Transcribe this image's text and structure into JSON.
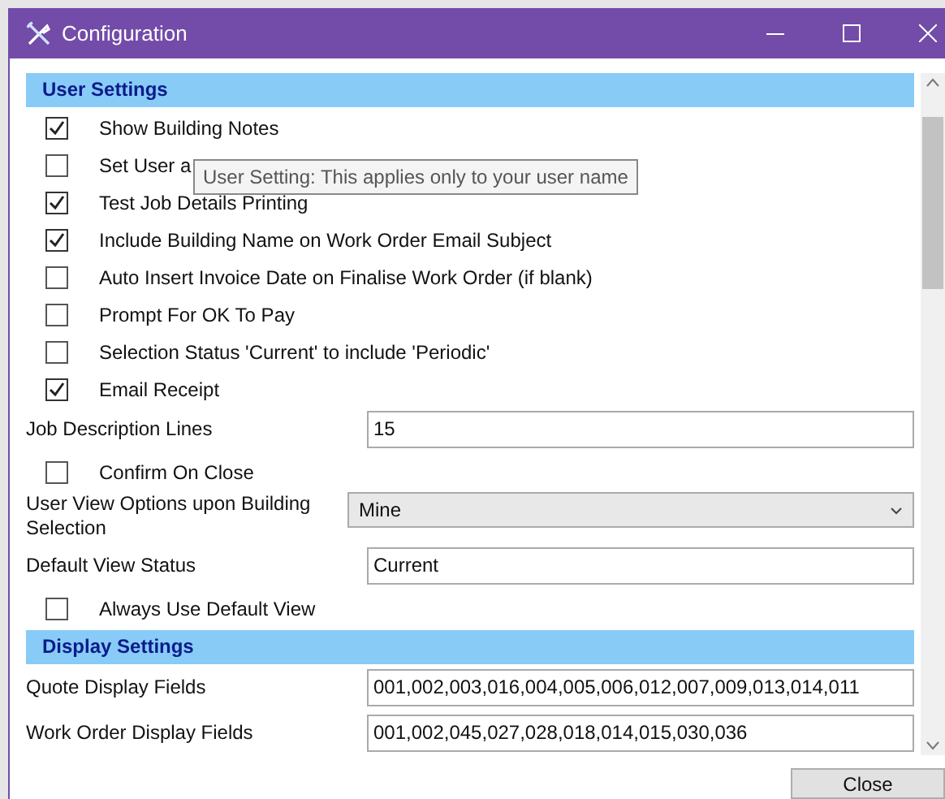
{
  "window": {
    "title": "Configuration"
  },
  "sections": [
    {
      "title": "User Settings",
      "items": [
        {
          "kind": "checkbox",
          "label": "Show Building Notes",
          "checked": true
        },
        {
          "kind": "checkbox",
          "label": "Set User a",
          "checked": false
        },
        {
          "kind": "checkbox",
          "label": "Test Job Details Printing",
          "checked": true
        },
        {
          "kind": "checkbox",
          "label": "Include Building Name on Work Order Email Subject",
          "checked": true
        },
        {
          "kind": "checkbox",
          "label": "Auto Insert Invoice Date on Finalise Work Order (if blank)",
          "checked": false
        },
        {
          "kind": "checkbox",
          "label": "Prompt For OK To Pay",
          "checked": false
        },
        {
          "kind": "checkbox",
          "label": "Selection Status 'Current' to include 'Periodic'",
          "checked": false
        },
        {
          "kind": "checkbox",
          "label": "Email Receipt",
          "checked": true
        },
        {
          "kind": "text",
          "label": "Job Description Lines",
          "value": "15"
        },
        {
          "kind": "checkbox",
          "label": "Confirm On Close",
          "checked": false
        },
        {
          "kind": "dropdown",
          "label": "User View Options upon Building Selection",
          "value": "Mine"
        },
        {
          "kind": "text",
          "label": "Default View Status",
          "value": "Current"
        },
        {
          "kind": "checkbox",
          "label": "Always Use Default View",
          "checked": false
        }
      ]
    },
    {
      "title": "Display Settings",
      "items": [
        {
          "kind": "text",
          "label": "Quote Display Fields",
          "value": "001,002,003,016,004,005,006,012,007,009,013,014,011"
        },
        {
          "kind": "text",
          "label": "Work Order Display Fields",
          "value": "001,002,045,027,028,018,014,015,030,036"
        }
      ]
    }
  ],
  "tooltip": {
    "text": "User Setting: This applies only to your user name"
  },
  "buttons": [
    "Close"
  ]
}
